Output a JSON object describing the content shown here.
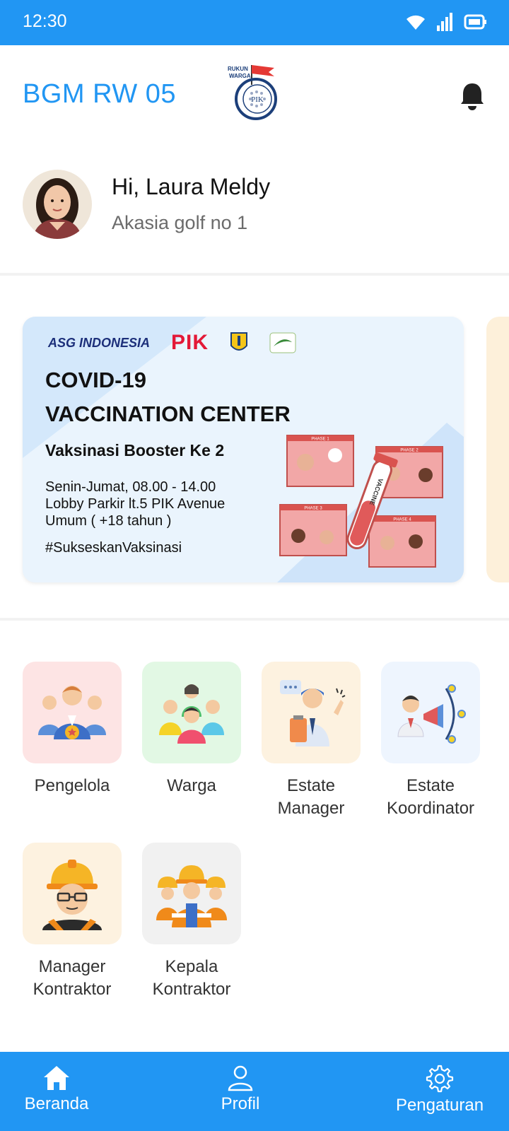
{
  "status_bar": {
    "time": "12:30",
    "icons": [
      "wifi-icon",
      "signal-icon",
      "battery-icon"
    ]
  },
  "header": {
    "title": "BGM RW 05",
    "logo_text_top": "RUKUN",
    "logo_text_mid": "WARGA",
    "logo_center": "PIK"
  },
  "profile": {
    "greeting": "Hi, Laura Meldy",
    "address": "Akasia golf no 1"
  },
  "banner": {
    "logo_asg": "ASG INDONESIA",
    "logo_pik": "PIK",
    "title_line1": "COVID-19",
    "title_line2": "VACCINATION CENTER",
    "subtitle": "Vaksinasi Booster Ke 2",
    "schedule": "Senin-Jumat, 08.00 - 14.00",
    "location": "Lobby Parkir lt.5 PIK Avenue",
    "audience": "Umum ( +18 tahun )",
    "hashtag": "#SukseskanVaksinasi",
    "phases": [
      "PHASE 1",
      "PHASE 2",
      "PHASE 3",
      "PHASE 4"
    ],
    "vial_label": "VACCINE"
  },
  "menu": [
    {
      "label": "Pengelola",
      "bg": "#fde4e4"
    },
    {
      "label": "Warga",
      "bg": "#e2f8e4"
    },
    {
      "label": "Estate\nManager",
      "bg": "#fdf2e0"
    },
    {
      "label": "Estate\nKoordinator",
      "bg": "#eef5fe"
    },
    {
      "label": "Manager\nKontraktor",
      "bg": "#fdf2e0"
    },
    {
      "label": "Kepala\nKontraktor",
      "bg": "#f1f1f1"
    }
  ],
  "bottom_nav": {
    "home": "Beranda",
    "profile": "Profil",
    "settings": "Pengaturan"
  },
  "colors": {
    "primary": "#2196F3"
  }
}
